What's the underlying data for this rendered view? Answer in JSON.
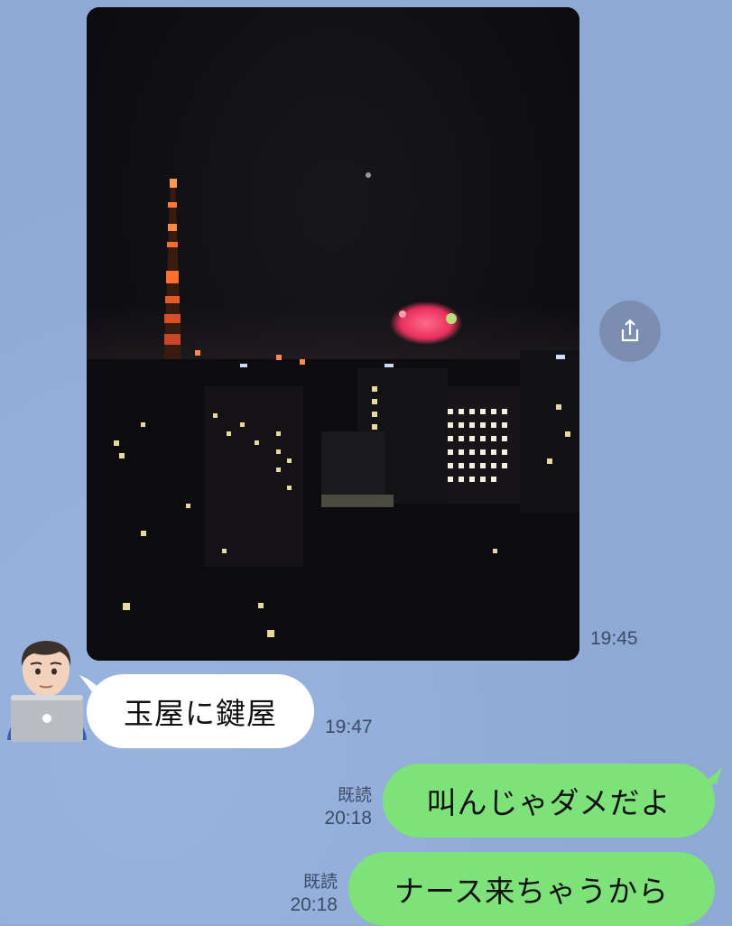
{
  "colors": {
    "background": "#8fa9d6",
    "incoming_bubble": "#ffffff",
    "outgoing_bubble": "#7ee27a",
    "share_button": "#7b8eb0"
  },
  "messages": {
    "photo": {
      "icon": "fireworks-photo",
      "time": "19:45",
      "share_icon": "share-icon"
    },
    "incoming_1": {
      "text": "玉屋に鍵屋",
      "time": "19:47",
      "avatar_icon": "man-with-laptop-avatar"
    },
    "outgoing_1": {
      "read": "既読",
      "time": "20:18",
      "text": "叫んじゃダメだよ"
    },
    "outgoing_2": {
      "read": "既読",
      "time": "20:18",
      "text": "ナース来ちゃうから"
    }
  }
}
